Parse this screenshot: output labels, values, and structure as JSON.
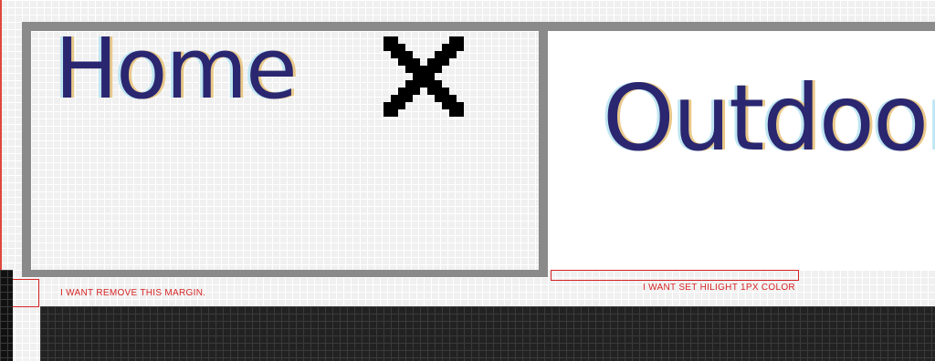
{
  "tabs": [
    {
      "label": "Home",
      "active": true,
      "close_icon": "close-icon"
    },
    {
      "label": "Outdoor",
      "active": false
    }
  ],
  "annotations": {
    "margin_note": "I WANT REMOVE THIS MARGIN.",
    "hilight_note": "I WANT SET HILIGHT 1PX COLOR"
  },
  "colors": {
    "tab_border": "#8a8a8a",
    "annotation": "#d62424",
    "content_bar": "#222222",
    "tab_text": "#2a2670"
  }
}
